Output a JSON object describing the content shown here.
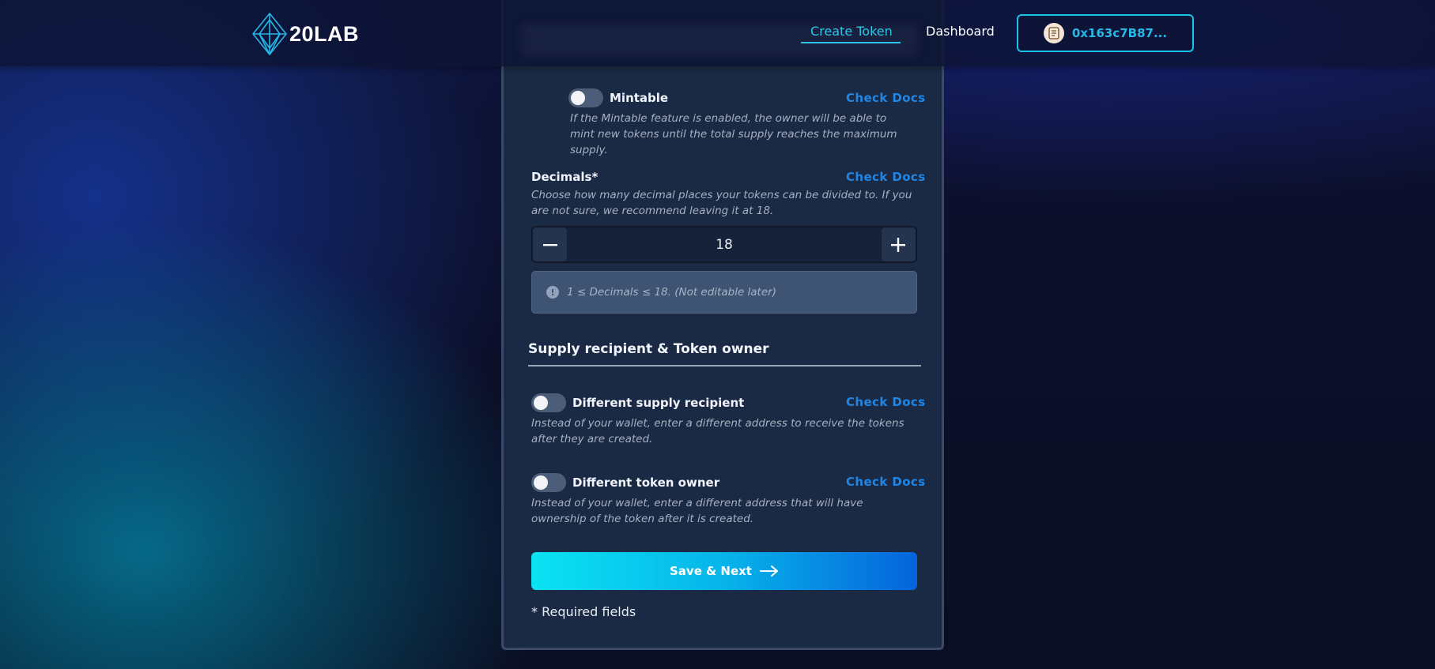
{
  "header": {
    "logo_text": "20LAB",
    "nav": [
      {
        "label": "Create Token",
        "active": true
      },
      {
        "label": "Dashboard",
        "active": false
      }
    ],
    "wallet_address": "0x163c7B87..."
  },
  "form": {
    "mintable": {
      "label": "Mintable",
      "enabled": false,
      "docs_link": "Check Docs",
      "description": "If the Mintable feature is enabled, the owner will be able to mint new tokens until the total supply reaches the maximum supply."
    },
    "decimals": {
      "label": "Decimals*",
      "docs_link": "Check Docs",
      "description": "Choose how many decimal places your tokens can be divided to. If you are not sure, we recommend leaving it at 18.",
      "value": "18",
      "info": "1 ≤ Decimals ≤ 18. (Not editable later)"
    },
    "section_title": "Supply recipient & Token owner",
    "supply_recipient": {
      "label": "Different supply recipient",
      "enabled": false,
      "docs_link": "Check Docs",
      "description": "Instead of your wallet, enter a different address to receive the tokens after they are created."
    },
    "token_owner": {
      "label": "Different token owner",
      "enabled": false,
      "docs_link": "Check Docs",
      "description": "Instead of your wallet, enter a different address that will have ownership of the token after it is created."
    },
    "submit_label": "Save & Next",
    "required_note": "* Required fields"
  },
  "colors": {
    "accent": "#1f86e6",
    "cta_start": "#0be3f2",
    "cta_end": "#0564dc",
    "card_bg": "#1b2a44"
  }
}
